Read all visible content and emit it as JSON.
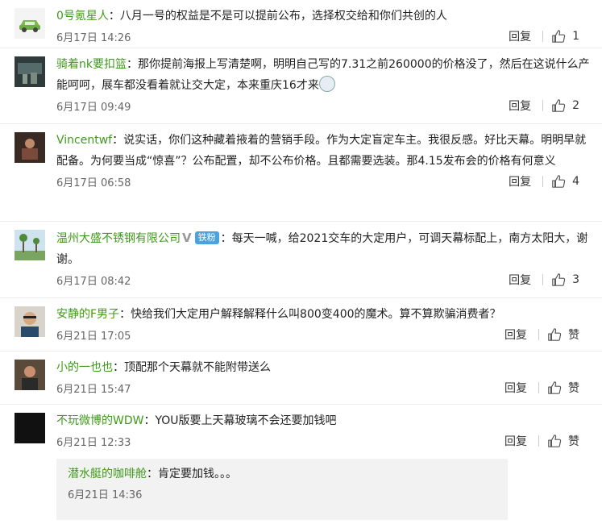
{
  "labels": {
    "reply": "回复"
  },
  "comments": [
    {
      "user": "0号氪星人",
      "sep": "：",
      "text": "八月一号的权益是不是可以提前公布，选择权交给和你们共创的人",
      "time": "6月17日 14:26",
      "likes": "1"
    },
    {
      "user": "骑着nk要扣篮",
      "sep": "：",
      "text": "那你提前海报上写清楚啊，明明自己写的7.31之前260000的价格没了，然后在这说什么产能呵呵，展车都没看着就让交大定，本来重庆16才来",
      "time": "6月17日 09:49",
      "likes": "2"
    },
    {
      "user": "Vincentwf",
      "sep": "：",
      "text": "说实话，你们这种藏着掖着的营销手段。作为大定盲定车主。我很反感。好比天幕。明明早就配备。为何要当成“惊喜”？公布配置，却不公布价格。且都需要选装。那4.15发布会的价格有何意义",
      "time": "6月17日 06:58",
      "likes": "4"
    },
    {
      "user": "温州大盛不锈钢有限公司",
      "verified": "V",
      "badge": "铁粉",
      "sep": "：",
      "text": "每天一喊，给2021交车的大定用户，可调天幕标配上，南方太阳大，谢谢。",
      "time": "6月17日 08:42",
      "likes": "3"
    },
    {
      "user": "安静的F男子",
      "sep": "：",
      "text": "快给我们大定用户解释解释什么叫800变400的魔术。算不算欺骗消费者？",
      "time": "6月21日 17:05",
      "likes": "赞"
    },
    {
      "user": "小的一也也",
      "sep": "：",
      "text": "顶配那个天幕就不能附带送么",
      "time": "6月21日 15:47",
      "likes": "赞"
    },
    {
      "user": "不玩微博的WDW",
      "sep": "：",
      "text": "YOU版要上天幕玻璃不会还要加钱吧",
      "time": "6月21日 12:33",
      "likes": "赞"
    }
  ],
  "sub_reply": {
    "user": "潜水艇的咖啡舱",
    "sep": "：",
    "text": "肯定要加钱。。。",
    "time": "6月21日 14:36"
  }
}
